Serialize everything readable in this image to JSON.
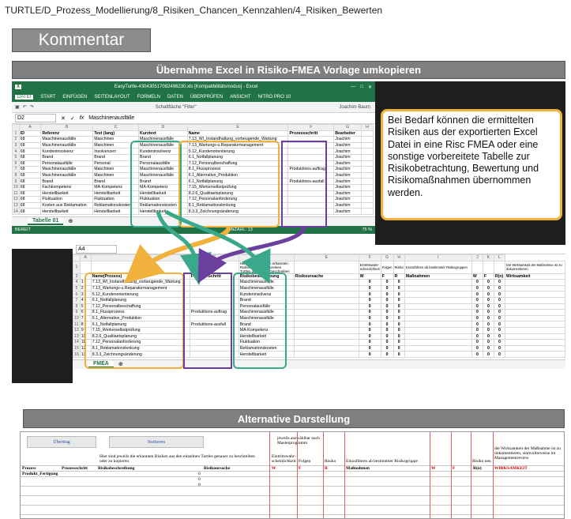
{
  "header": {
    "path": "TURTLE/D_Prozess_Modellierung/8_Risiken_Chancen_Kennzahlen/4_Risiken_Bewerten",
    "kommentar": "Kommentar",
    "banner": "Übernahme Excel in Risiko-FMEA Vorlage umkopieren",
    "banner2": "Alternative Darstellung"
  },
  "excel_top": {
    "title": "EasyTurtle-430430517082496230.xls [Kompatibilitätsmodus] - Excel",
    "tabs": [
      "DATEI",
      "START",
      "EINFÜGEN",
      "SEITENLAYOUT",
      "FORMELN",
      "DATEN",
      "ÜBERPRÜFEN",
      "ANSICHT",
      "NITRO PRO 10"
    ],
    "user": "Joachim Baum",
    "qat_text": "Schaltfläche \"Filter\"",
    "namebox": "D2",
    "formula": "Maschinenausfälle",
    "col_letters": [
      "",
      "A",
      "B",
      "C",
      "D",
      "E",
      "F",
      "G",
      "H"
    ],
    "headers": [
      "ID",
      "Referenz",
      "Text (lang)",
      "Kurztext",
      "Name",
      "Prozessschritt",
      "Bearbeiter"
    ],
    "rows": [
      [
        "68",
        "Maschinenausfälle",
        "Maschinen",
        "Maschinenausfälle",
        "7.13_WI_Instandhaltung_vorbeugende_Wartung",
        "",
        "Joachim"
      ],
      [
        "68",
        "Maschinenausfälle",
        "Maschinen",
        "Maschinenausfälle",
        "7.13_Wartungs-u.Reparaturmanagement",
        "",
        "Joachim"
      ],
      [
        "68",
        "Kundeninsolvenz",
        "Insolvenzen",
        "Kundeninsolvenz",
        "5.12_Kundenorientierung",
        "",
        "Joachim"
      ],
      [
        "68",
        "Brand",
        "Brand",
        "Brand",
        "6.1_Notfallplanung",
        "",
        "Joachim"
      ],
      [
        "68",
        "Personalausfälle",
        "Personal",
        "Personalausfälle",
        "7.12_Personalbeschaffung",
        "",
        "Joachim"
      ],
      [
        "68",
        "Maschinenausfälle",
        "Maschinen",
        "Maschinenausfälle",
        "8.1_Flussprozess",
        "Produktions-auftrag",
        "Joachim"
      ],
      [
        "68",
        "Maschinenausfälle",
        "Maschinen",
        "Maschinenausfälle",
        "6.1_Alternative_Produktion",
        "",
        "Joachim"
      ],
      [
        "68",
        "Brand",
        "Brand",
        "Brand",
        "6.1_Notfallplanung",
        "Produktions-ausfall",
        "Joachim"
      ],
      [
        "68",
        "Fachkompetenz",
        "MA-Kompetenz",
        "MA-Kompetenz",
        "7.15_Werkerselbstprüfung",
        "",
        "Joachim"
      ],
      [
        "68",
        "Herstellbarkeit",
        "Herstellbarkeit",
        "Herstellbarkeit",
        "8.2.6_Qualitaetsplanung",
        "",
        "Joachim"
      ],
      [
        "68",
        "Fluktuation",
        "Fluktuation",
        "Fluktuation",
        "7.12_Personalanforderung",
        "",
        "Joachim"
      ],
      [
        "68",
        "Kosten aus Reklamation",
        "Reklamationskosten",
        "Reklamationskosten",
        "8.1_Reklamationslenkung",
        "",
        "Joachim"
      ],
      [
        "68",
        "Herstellbarkeit",
        "Herstellbarkeit",
        "Herstellbarkeit",
        "8.3.3_Zeichnungsänderung",
        "",
        "Joachim"
      ]
    ],
    "sheet_tab": "Tabelle 01",
    "status_left": "BEREIT",
    "status_mid": "ANZAHL: 13",
    "zoom": "75 %"
  },
  "callout": {
    "text": "Bei Bedarf können die ermittelten Risiken aus der exportierten Excel Datei in eine Risc FMEA oder eine sonstige vorbereitete Tabelle zur Risikobetrachtung, Bewertung und Risikomaßnahmen übernommen werden."
  },
  "excel_bottom": {
    "namebox": "A4",
    "col_letters": [
      "",
      "A",
      "B",
      "C",
      "D",
      "E",
      "F",
      "G",
      "H",
      "I",
      "J",
      "K",
      "L"
    ],
    "top_note": "Hier sind jeweils die erkannten Risiken aus den einzelnen Turtles genauer zu beschreiben",
    "top_note2": "Eintrittswahr-scheinlichkeit",
    "top_note3": "Folgen",
    "top_note4": "Risiko",
    "top_note5": "Einzuführen ab bestimmter Risikogruppen",
    "top_note6": "Die Wirksamkeit der Maßnahme ist zu dokumentieren",
    "headers": [
      "Name(Prozess)",
      "Prozess-Schritt",
      "Risikobeschreibung",
      "Risikoursache",
      "W",
      "F",
      "R",
      "Maßnahmen",
      "W",
      "F",
      "R(n)",
      "Wirksamkeit"
    ],
    "rows": [
      [
        "7.13_WI_Instandhaltung_vorbeugende_Wartung",
        "",
        "Maschinenausfälle"
      ],
      [
        "7.13_Wartungs-u.Reparaturmanagement",
        "",
        "Maschinenausfälle"
      ],
      [
        "5.12_Kundenorientierung",
        "",
        "Kundeninsolvenz"
      ],
      [
        "6.1_Notfallplanung",
        "",
        "Brand"
      ],
      [
        "7.12_Personalbeschaffung",
        "",
        "Personalausfälle"
      ],
      [
        "8.1_Flussprozess",
        "Produktions-auftrag",
        "Maschinenausfälle"
      ],
      [
        "6.1_Alternative_Produktion",
        "",
        "Maschinenausfälle"
      ],
      [
        "6.1_Notfallplanung",
        "Produktions-ausfall",
        "Brand"
      ],
      [
        "7.15_Werkerselbstprüfung",
        "",
        "MA-Kompetenz"
      ],
      [
        "8.2.6_Qualitaetsplanung",
        "",
        "Herstellbarkeit"
      ],
      [
        "7.12_Personalanforderung",
        "",
        "Fluktuation"
      ],
      [
        "8.1_Reklamationslenkung",
        "",
        "Reklamationskosten"
      ],
      [
        "8.3.3_Zeichnungsänderung",
        "",
        "Herstellbarkeit"
      ]
    ],
    "zero": "0",
    "sheet_tab": "FMEA"
  },
  "alt": {
    "btn1": "Übertrag",
    "btn2": "Sortieren",
    "note_top": "jeweils auswählbar nach Masterprogramm",
    "note_left": "Hier sind jeweils die erkannten Risiken aus den einzelnen Turtles genauer zu beschreiben oder zu kopieren",
    "note_right": "die Wirksamkeit der Maßnahme ist zu dokumentieren, sinnvollerweise im Managementreview",
    "h_ew": "Eintrittswahr-scheinlichkeit",
    "h_folgen": "Folgen",
    "h_risiko": "Risiko",
    "h_einz": "Einzuführen ab bestimmter Risikogruppe",
    "h_risiko_neu": "Risiko neu",
    "cols": [
      "Prozess",
      "Prozessschritt",
      "Risikobeschreibung",
      "Risikoursache",
      "W",
      "F",
      "R",
      "Maßnahmen",
      "W",
      "F",
      "R(n)",
      "WIRKSAMKEIT"
    ],
    "row1": "Produkt_Fertigung",
    "zero": "0"
  }
}
